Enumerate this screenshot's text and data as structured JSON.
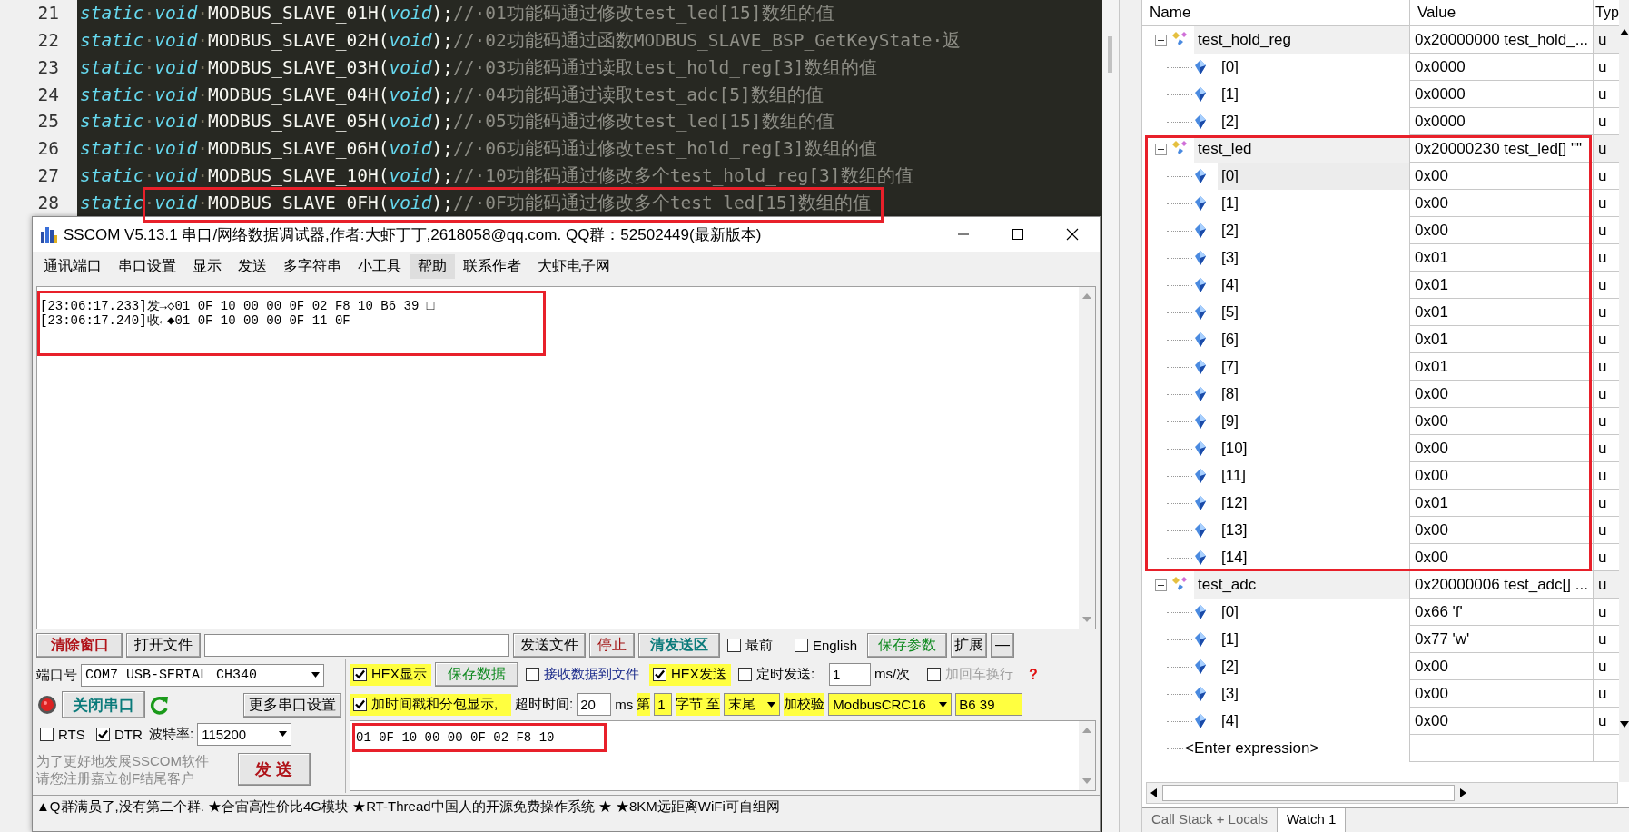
{
  "editor": {
    "lines": [
      {
        "number": "21",
        "highlighted": false,
        "tokens": [
          {
            "kind": "keyword",
            "text": "static"
          },
          {
            "kind": "space",
            "text": "·"
          },
          {
            "kind": "keyword",
            "text": "void"
          },
          {
            "kind": "space",
            "text": "·"
          },
          {
            "kind": "plain",
            "text": "MODBUS_SLAVE_01H("
          },
          {
            "kind": "keyword",
            "text": "void"
          },
          {
            "kind": "plain",
            "text": ");"
          },
          {
            "kind": "comment",
            "text": "//·01功能码通过修改test_led[15]数组的值"
          }
        ]
      },
      {
        "number": "22",
        "highlighted": false,
        "tokens": [
          {
            "kind": "keyword",
            "text": "static"
          },
          {
            "kind": "space",
            "text": "·"
          },
          {
            "kind": "keyword",
            "text": "void"
          },
          {
            "kind": "space",
            "text": "·"
          },
          {
            "kind": "plain",
            "text": "MODBUS_SLAVE_02H("
          },
          {
            "kind": "keyword",
            "text": "void"
          },
          {
            "kind": "plain",
            "text": ");"
          },
          {
            "kind": "comment",
            "text": "//·02功能码通过函数MODBUS_SLAVE_BSP_GetKeyState·返"
          }
        ]
      },
      {
        "number": "23",
        "highlighted": false,
        "tokens": [
          {
            "kind": "keyword",
            "text": "static"
          },
          {
            "kind": "space",
            "text": "·"
          },
          {
            "kind": "keyword",
            "text": "void"
          },
          {
            "kind": "space",
            "text": "·"
          },
          {
            "kind": "plain",
            "text": "MODBUS_SLAVE_03H("
          },
          {
            "kind": "keyword",
            "text": "void"
          },
          {
            "kind": "plain",
            "text": ");"
          },
          {
            "kind": "comment",
            "text": "//·03功能码通过读取test_hold_reg[3]数组的值"
          }
        ]
      },
      {
        "number": "24",
        "highlighted": false,
        "tokens": [
          {
            "kind": "keyword",
            "text": "static"
          },
          {
            "kind": "space",
            "text": "·"
          },
          {
            "kind": "keyword",
            "text": "void"
          },
          {
            "kind": "space",
            "text": "·"
          },
          {
            "kind": "plain",
            "text": "MODBUS_SLAVE_04H("
          },
          {
            "kind": "keyword",
            "text": "void"
          },
          {
            "kind": "plain",
            "text": ");"
          },
          {
            "kind": "comment",
            "text": "//·04功能码通过读取test_adc[5]数组的值"
          }
        ]
      },
      {
        "number": "25",
        "highlighted": false,
        "tokens": [
          {
            "kind": "keyword",
            "text": "static"
          },
          {
            "kind": "space",
            "text": "·"
          },
          {
            "kind": "keyword",
            "text": "void"
          },
          {
            "kind": "space",
            "text": "·"
          },
          {
            "kind": "plain",
            "text": "MODBUS_SLAVE_05H("
          },
          {
            "kind": "keyword",
            "text": "void"
          },
          {
            "kind": "plain",
            "text": ");"
          },
          {
            "kind": "comment",
            "text": "//·05功能码通过修改test_led[15]数组的值"
          }
        ]
      },
      {
        "number": "26",
        "highlighted": false,
        "tokens": [
          {
            "kind": "keyword",
            "text": "static"
          },
          {
            "kind": "space",
            "text": "·"
          },
          {
            "kind": "keyword",
            "text": "void"
          },
          {
            "kind": "space",
            "text": "·"
          },
          {
            "kind": "plain",
            "text": "MODBUS_SLAVE_06H("
          },
          {
            "kind": "keyword",
            "text": "void"
          },
          {
            "kind": "plain",
            "text": ");"
          },
          {
            "kind": "comment",
            "text": "//·06功能码通过修改test_hold_reg[3]数组的值"
          }
        ]
      },
      {
        "number": "27",
        "highlighted": false,
        "tokens": [
          {
            "kind": "keyword",
            "text": "static"
          },
          {
            "kind": "space",
            "text": "·"
          },
          {
            "kind": "keyword",
            "text": "void"
          },
          {
            "kind": "space",
            "text": "·"
          },
          {
            "kind": "plain",
            "text": "MODBUS_SLAVE_10H("
          },
          {
            "kind": "keyword",
            "text": "void"
          },
          {
            "kind": "plain",
            "text": ");"
          },
          {
            "kind": "comment",
            "text": "//·10功能码通过修改多个test_hold_reg[3]数组的值"
          }
        ]
      },
      {
        "number": "28",
        "highlighted": true,
        "tokens": [
          {
            "kind": "keyword",
            "text": "static"
          },
          {
            "kind": "space",
            "text": "·"
          },
          {
            "kind": "keyword",
            "text": "void"
          },
          {
            "kind": "space",
            "text": "·"
          },
          {
            "kind": "plain",
            "text": "MODBUS_SLAVE_0FH("
          },
          {
            "kind": "keyword",
            "text": "void"
          },
          {
            "kind": "plain",
            "text": ");"
          },
          {
            "kind": "comment",
            "text": "//·0F功能码通过修改多个test_led[15]数组的值"
          }
        ]
      }
    ]
  },
  "sscom": {
    "title": "SSCOM V5.13.1 串口/网络数据调试器,作者:大虾丁丁,2618058@qq.com. QQ群：52502449(最新版本)",
    "menu": [
      {
        "label": "通讯端口",
        "selected": false
      },
      {
        "label": "串口设置",
        "selected": false
      },
      {
        "label": "显示",
        "selected": false
      },
      {
        "label": "发送",
        "selected": false
      },
      {
        "label": "多字符串",
        "selected": false
      },
      {
        "label": "小工具",
        "selected": false
      },
      {
        "label": "帮助",
        "selected": true
      },
      {
        "label": "联系作者",
        "selected": false
      },
      {
        "label": "大虾电子网",
        "selected": false
      }
    ],
    "receive": {
      "highlighted": true,
      "lines": [
        "[23:06:17.233]发→◇01 0F 10 00 00 0F 02 F8 10 B6 39 □",
        "[23:06:17.240]收←◆01 0F 10 00 00 0F 11 0F"
      ]
    },
    "toolbar": {
      "clear": "清除窗口",
      "open_file": "打开文件",
      "send_file": "发送文件",
      "stop": "停止",
      "clear_send": "清发送区",
      "topmost": {
        "label": "最前",
        "checked": false
      },
      "english": {
        "label": "English",
        "checked": false
      },
      "save_params": "保存参数",
      "expand": "扩展",
      "collapse": "—"
    },
    "port": {
      "label": "端口号",
      "value": "COM7 USB-SERIAL CH340"
    },
    "hex_display": {
      "label": "HEX显示",
      "checked": true
    },
    "save_data": "保存数据",
    "recv_to_file": {
      "label": "接收数据到文件",
      "checked": false
    },
    "hex_send": {
      "label": "HEX发送",
      "checked": true
    },
    "timed_send": {
      "label": "定时发送:",
      "checked": false
    },
    "interval": {
      "value": "1",
      "unit": "ms/次"
    },
    "append_newline": {
      "label": "加回车换行",
      "checked": false,
      "disabled": true
    },
    "help_mark": "?",
    "close_port": "关闭串口",
    "more_settings": "更多串口设置",
    "timestamp": {
      "label": "加时间戳和分包显示,",
      "checked": true
    },
    "timeout": {
      "label": "超时时间:",
      "value": "20",
      "unit": "ms"
    },
    "byte_range": {
      "prefix": "第",
      "from": "1",
      "middle": "字节 至",
      "to": "末尾"
    },
    "checksum": {
      "label": "加校验",
      "value": "ModbusCRC16",
      "result": "B6 39"
    },
    "rts": {
      "label": "RTS",
      "checked": false
    },
    "dtr": {
      "label": "DTR",
      "checked": true
    },
    "baud": {
      "label": "波特率:",
      "value": "115200"
    },
    "send_box": {
      "text": "01 0F 10 00 00 0F 02 F8 10",
      "highlighted": true
    },
    "promo": [
      "为了更好地发展SSCOM软件",
      "请您注册嘉立创F结尾客户"
    ],
    "send": "发 送",
    "status": "▲Q群满员了,没有第二个群. ★合宙高性价比4G模块 ★RT-Thread中国人的开源免费操作系统 ★ ★8KM远距离WiFi可自组网"
  },
  "watch": {
    "columns": [
      "Name",
      "Value",
      "Typ"
    ],
    "groups": [
      {
        "name": "test_hold_reg",
        "value": "0x20000000 test_hold_...",
        "type": "u",
        "expanded": true,
        "highlighted": false,
        "children": [
          {
            "name": "[0]",
            "value": "0x0000",
            "type": "u",
            "selected": false
          },
          {
            "name": "[1]",
            "value": "0x0000",
            "type": "u",
            "selected": false
          },
          {
            "name": "[2]",
            "value": "0x0000",
            "type": "u",
            "selected": false
          }
        ]
      },
      {
        "name": "test_led",
        "value": "0x20000230 test_led[] \"\"",
        "type": "u",
        "expanded": true,
        "highlighted": true,
        "children": [
          {
            "name": "[0]",
            "value": "0x00",
            "type": "u",
            "selected": true
          },
          {
            "name": "[1]",
            "value": "0x00",
            "type": "u",
            "selected": false
          },
          {
            "name": "[2]",
            "value": "0x00",
            "type": "u",
            "selected": false
          },
          {
            "name": "[3]",
            "value": "0x01",
            "type": "u",
            "selected": false
          },
          {
            "name": "[4]",
            "value": "0x01",
            "type": "u",
            "selected": false
          },
          {
            "name": "[5]",
            "value": "0x01",
            "type": "u",
            "selected": false
          },
          {
            "name": "[6]",
            "value": "0x01",
            "type": "u",
            "selected": false
          },
          {
            "name": "[7]",
            "value": "0x01",
            "type": "u",
            "selected": false
          },
          {
            "name": "[8]",
            "value": "0x00",
            "type": "u",
            "selected": false
          },
          {
            "name": "[9]",
            "value": "0x00",
            "type": "u",
            "selected": false
          },
          {
            "name": "[10]",
            "value": "0x00",
            "type": "u",
            "selected": false
          },
          {
            "name": "[11]",
            "value": "0x00",
            "type": "u",
            "selected": false
          },
          {
            "name": "[12]",
            "value": "0x01",
            "type": "u",
            "selected": false
          },
          {
            "name": "[13]",
            "value": "0x00",
            "type": "u",
            "selected": false
          },
          {
            "name": "[14]",
            "value": "0x00",
            "type": "u",
            "selected": false
          }
        ]
      },
      {
        "name": "test_adc",
        "value": "0x20000006 test_adc[] ...",
        "type": "u",
        "expanded": true,
        "highlighted": false,
        "children": [
          {
            "name": "[0]",
            "value": "0x66 'f'",
            "type": "u",
            "selected": false
          },
          {
            "name": "[1]",
            "value": "0x77 'w'",
            "type": "u",
            "selected": false
          },
          {
            "name": "[2]",
            "value": "0x00",
            "type": "u",
            "selected": false
          },
          {
            "name": "[3]",
            "value": "0x00",
            "type": "u",
            "selected": false
          },
          {
            "name": "[4]",
            "value": "0x00",
            "type": "u",
            "selected": false
          }
        ]
      }
    ],
    "enter_expression": "<Enter expression>",
    "tabs": [
      {
        "label": "Call Stack + Locals",
        "selected": false
      },
      {
        "label": "Watch 1",
        "selected": true
      }
    ]
  }
}
